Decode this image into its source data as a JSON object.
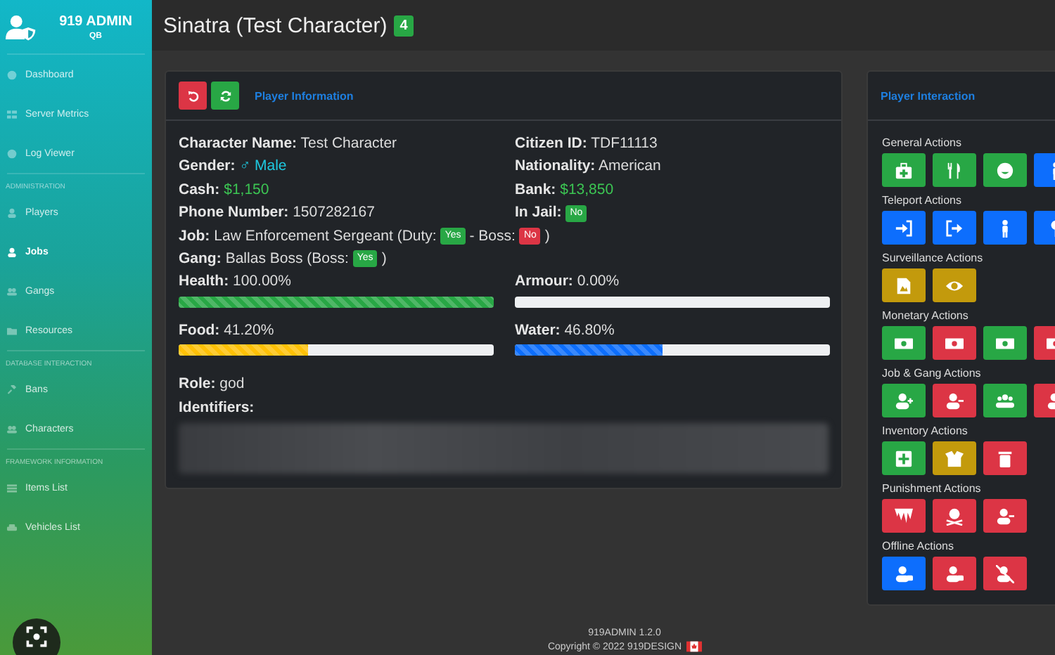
{
  "sidebar": {
    "brand": "919 ADMIN",
    "sub": "QB",
    "sections": [
      {
        "items": [
          {
            "label": "Dashboard",
            "selected": false
          },
          {
            "label": "Server Metrics",
            "selected": false
          },
          {
            "label": "Log Viewer",
            "selected": false
          }
        ]
      },
      {
        "heading": "ADMINISTRATION",
        "items": [
          {
            "label": "Players",
            "selected": false
          },
          {
            "label": "Jobs",
            "selected": true
          },
          {
            "label": "Gangs",
            "selected": false
          },
          {
            "label": "Resources",
            "selected": false
          }
        ]
      },
      {
        "heading": "DATABASE INTERACTION",
        "items": [
          {
            "label": "Bans",
            "selected": false
          },
          {
            "label": "Characters",
            "selected": false
          }
        ]
      },
      {
        "heading": "FRAMEWORK INFORMATION",
        "items": [
          {
            "label": "Items List",
            "selected": false
          },
          {
            "label": "Vehicles List",
            "selected": false
          }
        ]
      }
    ]
  },
  "page": {
    "title": "Sinatra (Test Character)",
    "badge": "4"
  },
  "player_info": {
    "title": "Player Information",
    "fields": [
      {
        "label": "Character Name:",
        "value": "Test Character",
        "kind": "plain"
      },
      {
        "label": "Citizen ID:",
        "value": "TDF11113",
        "kind": "plain"
      },
      {
        "label": "Gender:",
        "value": "♂ Male",
        "kind": "gender"
      },
      {
        "label": "Nationality:",
        "value": "American",
        "kind": "plain"
      },
      {
        "label": "Cash:",
        "value": "$1,150",
        "kind": "money"
      },
      {
        "label": "Bank:",
        "value": "$13,850",
        "kind": "money"
      },
      {
        "label": "Phone Number:",
        "value": "1507282167",
        "kind": "plain"
      },
      {
        "label": "In Jail:",
        "value": "No",
        "kind": "badge",
        "color": "#28a745"
      }
    ],
    "lines": [
      {
        "label": "Job:",
        "parts": [
          {
            "kind": "text",
            "text": "Law Enforcement Sergeant (Duty:"
          },
          {
            "kind": "badge",
            "text": "Yes",
            "color": "#28a745"
          },
          {
            "kind": "text",
            "text": "- Boss:"
          },
          {
            "kind": "badge",
            "text": "No",
            "color": "#dc3545"
          },
          {
            "kind": "text",
            "text": ")"
          }
        ]
      },
      {
        "label": "Gang:",
        "parts": [
          {
            "kind": "text",
            "text": "Ballas Boss (Boss:"
          },
          {
            "kind": "badge",
            "text": "Yes",
            "color": "#28a745"
          },
          {
            "kind": "text",
            "text": ")"
          }
        ]
      }
    ],
    "bars": [
      {
        "label": "Health:",
        "reading": "100.00%",
        "level": 1.0,
        "color": "#28a745"
      },
      {
        "label": "Armour:",
        "reading": "0.00%"
      },
      {
        "label": "Food:",
        "reading": "41.20%",
        "level": 0.412,
        "color": "#ffc107"
      },
      {
        "label": "Water:",
        "reading": "46.80%",
        "level": 0.468,
        "color": "#0d6efd"
      }
    ],
    "role": {
      "label": "Role:",
      "value": "god"
    },
    "identifiers": {
      "label": "Identifiers:"
    }
  },
  "interaction": {
    "title": "Player Interaction",
    "groups": [
      {
        "title": "General Actions",
        "buttons": [
          {
            "color": "#28a745"
          },
          {
            "color": "#28a745"
          },
          {
            "color": "#28a745"
          },
          {
            "color": "#0d6efd"
          }
        ]
      },
      {
        "title": "Teleport Actions",
        "buttons": [
          {
            "color": "#0d6efd"
          },
          {
            "color": "#0d6efd"
          },
          {
            "color": "#0d6efd"
          },
          {
            "color": "#0d6efd"
          }
        ]
      },
      {
        "title": "Surveillance Actions",
        "buttons": [
          {
            "color": "#c39a0c"
          },
          {
            "color": "#c39a0c"
          }
        ]
      },
      {
        "title": "Monetary Actions",
        "buttons": [
          {
            "color": "#28a745"
          },
          {
            "color": "#dc3545"
          },
          {
            "color": "#28a745"
          },
          {
            "color": "#dc3545"
          }
        ]
      },
      {
        "title": "Job & Gang Actions",
        "buttons": [
          {
            "color": "#28a745"
          },
          {
            "color": "#dc3545"
          },
          {
            "color": "#28a745"
          },
          {
            "color": "#dc3545"
          }
        ]
      },
      {
        "title": "Inventory Actions",
        "buttons": [
          {
            "color": "#28a745"
          },
          {
            "color": "#c39a0c"
          },
          {
            "color": "#dc3545"
          }
        ]
      },
      {
        "title": "Punishment Actions",
        "buttons": [
          {
            "color": "#dc3545"
          },
          {
            "color": "#dc3545"
          },
          {
            "color": "#dc3545"
          }
        ]
      },
      {
        "title": "Offline Actions",
        "buttons": [
          {
            "color": "#0d6efd"
          },
          {
            "color": "#dc3545"
          },
          {
            "color": "#dc3545"
          }
        ]
      }
    ]
  },
  "footer": {
    "version": "919ADMIN 1.2.0",
    "copyright": "Copyright © 2022 919DESIGN"
  }
}
